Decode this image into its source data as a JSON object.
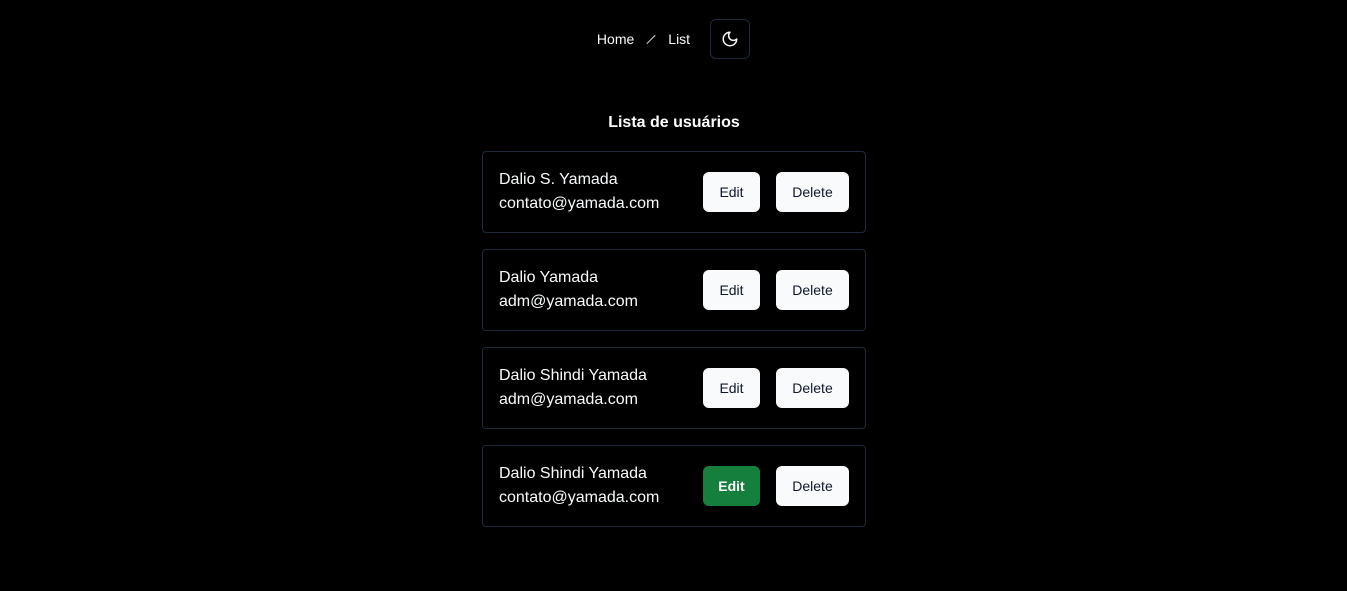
{
  "nav": {
    "breadcrumb": [
      {
        "label": "Home"
      },
      {
        "label": "List"
      }
    ],
    "theme_toggle_icon": "moon-icon"
  },
  "main": {
    "title": "Lista de usuários",
    "users": [
      {
        "name": "Dalio S. Yamada",
        "email": "contato@yamada.com",
        "edit_label": "Edit",
        "delete_label": "Delete",
        "edit_active": false
      },
      {
        "name": "Dalio Yamada",
        "email": "adm@yamada.com",
        "edit_label": "Edit",
        "delete_label": "Delete",
        "edit_active": false
      },
      {
        "name": "Dalio Shindi Yamada",
        "email": "adm@yamada.com",
        "edit_label": "Edit",
        "delete_label": "Delete",
        "edit_active": false
      },
      {
        "name": "Dalio Shindi Yamada",
        "email": "contato@yamada.com",
        "edit_label": "Edit",
        "delete_label": "Delete",
        "edit_active": true
      }
    ]
  },
  "colors": {
    "background": "#000000",
    "card_border": "#1e293b",
    "button_bg": "#f8fafc",
    "button_text": "#0f172a",
    "edit_active_bg": "#15803d"
  }
}
